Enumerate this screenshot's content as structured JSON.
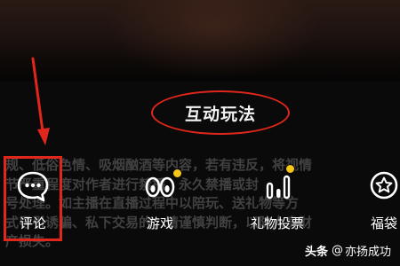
{
  "panel": {
    "title": "互动玩法",
    "notice_text": "规、低俗色情、吸烟酗酒等内容，若有违反，将视情\n节严重程度对作者进行禁播、永久禁播或封\n号处理。如主播在直播过程中以陪玩、送礼物等方\n式导引诱骗、私下交易的，请谨慎判断，以防人身财\n产损失。"
  },
  "items": [
    {
      "label": "评论",
      "icon": "comment-bubble-icon",
      "badge": false
    },
    {
      "label": "游戏",
      "icon": "game-eyes-icon",
      "badge": true
    },
    {
      "label": "礼物投票",
      "icon": "gift-vote-bars-icon",
      "badge": true
    },
    {
      "label": "福袋",
      "icon": "lucky-bag-star-icon",
      "badge": false
    }
  ],
  "annotations": {
    "highlight_color": "#e1261c",
    "badge_color": "#f5c518"
  },
  "watermark": {
    "brand": "头条",
    "at": "@",
    "author": "亦扬成功"
  }
}
